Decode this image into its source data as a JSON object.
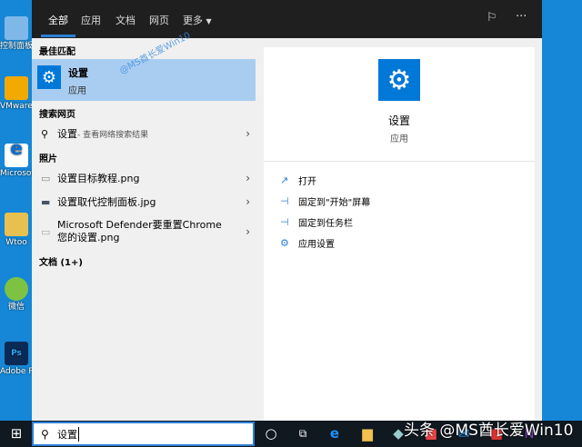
{
  "desktop": {
    "icons": [
      "控制面板",
      "VMware Workstation",
      "Microsoft Edge",
      "Wtoo",
      "微信",
      "Adobe Photoshop"
    ]
  },
  "tabs": [
    "全部",
    "应用",
    "文档",
    "网页",
    "更多"
  ],
  "left": {
    "best_match_header": "最佳匹配",
    "best_match": {
      "title": "设置",
      "subtitle": "应用"
    },
    "web_header": "搜索网页",
    "web_item": {
      "term": "设置",
      "suffix": " - 查看网络搜索结果"
    },
    "photos_header": "照片",
    "photos": [
      "设置目标教程.png",
      "设置取代控制面板.jpg",
      "Microsoft Defender要重置Chrome您的设置.png"
    ],
    "docs_header": "文档 (1+)"
  },
  "right": {
    "title": "设置",
    "subtitle": "应用",
    "actions": [
      "打开",
      "固定到\"开始\"屏幕",
      "固定到任务栏",
      "应用设置"
    ]
  },
  "watermark": "@MS酋长爱Win10",
  "taskbar": {
    "search_value": "设置",
    "watermark": "头条 @MS酋长爱Win10"
  },
  "colors": {
    "accent": "#0078d7",
    "desktop": "#1587d6",
    "highlight": "#a9cdf0"
  }
}
